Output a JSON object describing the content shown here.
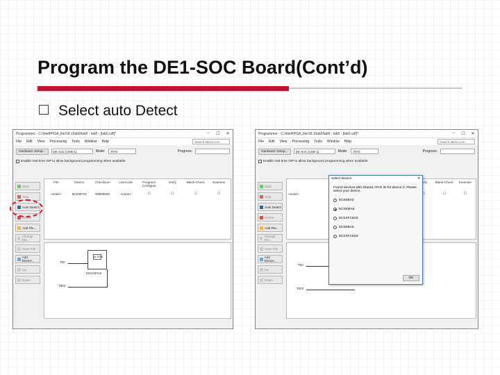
{
  "slide": {
    "title": "Program the DE1-SOC Board(Cont’d)",
    "bullet": "Select auto Detect",
    "accent_color": "#c8102e",
    "highlight_color": "#e0102a"
  },
  "left_window": {
    "title": "Programmer - C:/intelFPGA_lite/18.1/lab0/lab0 - lab0 - [lab0.cdf]*",
    "menu": [
      "File",
      "Edit",
      "View",
      "Processing",
      "Tools",
      "Window",
      "Help"
    ],
    "search_placeholder": "Search altera.com",
    "hardware_setup_label": "Hardware Setup...",
    "hardware_value": "DE-SoC [USB-1]",
    "mode_label": "Mode:",
    "mode_value": "JTAG",
    "progress_label": "Progress:",
    "enable_isp_label": "Enable real-time ISP to allow background programming when available",
    "side_buttons": [
      "Start",
      "Stop",
      "Auto Detect",
      "Delete",
      "Add File...",
      "Change File...",
      "Save File",
      "Add Device...",
      "Up",
      "Down"
    ],
    "columns": [
      "File",
      "Device",
      "Checksum",
      "Usercode",
      "Program/ Configure",
      "Verify",
      "Blank-Check",
      "Examine"
    ],
    "row": {
      "file": "<none>",
      "device": "5CGXFC5",
      "checksum": "00000000",
      "usercode": "<none>"
    },
    "chain": {
      "tdi": "TDI",
      "tdo": "TDO",
      "chip_label": "5CGXFC5",
      "chip_logo": "ALTERA"
    }
  },
  "right_window": {
    "title": "Programmer - C:/intelFPGA_lite/18.1/lab0/lab0 - lab0 - [lab0.cdf]*",
    "menu": [
      "File",
      "Edit",
      "View",
      "Processing",
      "Tools",
      "Window",
      "Help"
    ],
    "search_placeholder": "Search altera.com",
    "hardware_setup_label": "Hardware Setup...",
    "hardware_value": "DE-SoC [USB-1]",
    "mode_label": "Mode:",
    "mode_value": "JTAG",
    "progress_label": "Progress:",
    "enable_isp_label": "Enable real-time ISP to allow background programming when available",
    "side_buttons": [
      "Start",
      "Stop",
      "Auto Detect",
      "Delete",
      "Add File...",
      "Change File...",
      "Save File",
      "Add Device...",
      "Up",
      "Down"
    ],
    "columns": [
      "Verify",
      "Blank-Check",
      "Examine"
    ],
    "row_file": "<none>",
    "chain": {
      "tdi": "TDI",
      "tdo": "TDO"
    }
  },
  "dialog": {
    "title": "Select Device",
    "message": "Found devices with shared JTAG ID for device 2. Please select your device.",
    "options": [
      "5CSEBA2",
      "5CSEMA5",
      "5CSXFC6C6",
      "5CSEBA6",
      "5CSXFC5C6"
    ],
    "selected_index": 1,
    "ok_label": "OK",
    "close_glyph": "✕"
  }
}
